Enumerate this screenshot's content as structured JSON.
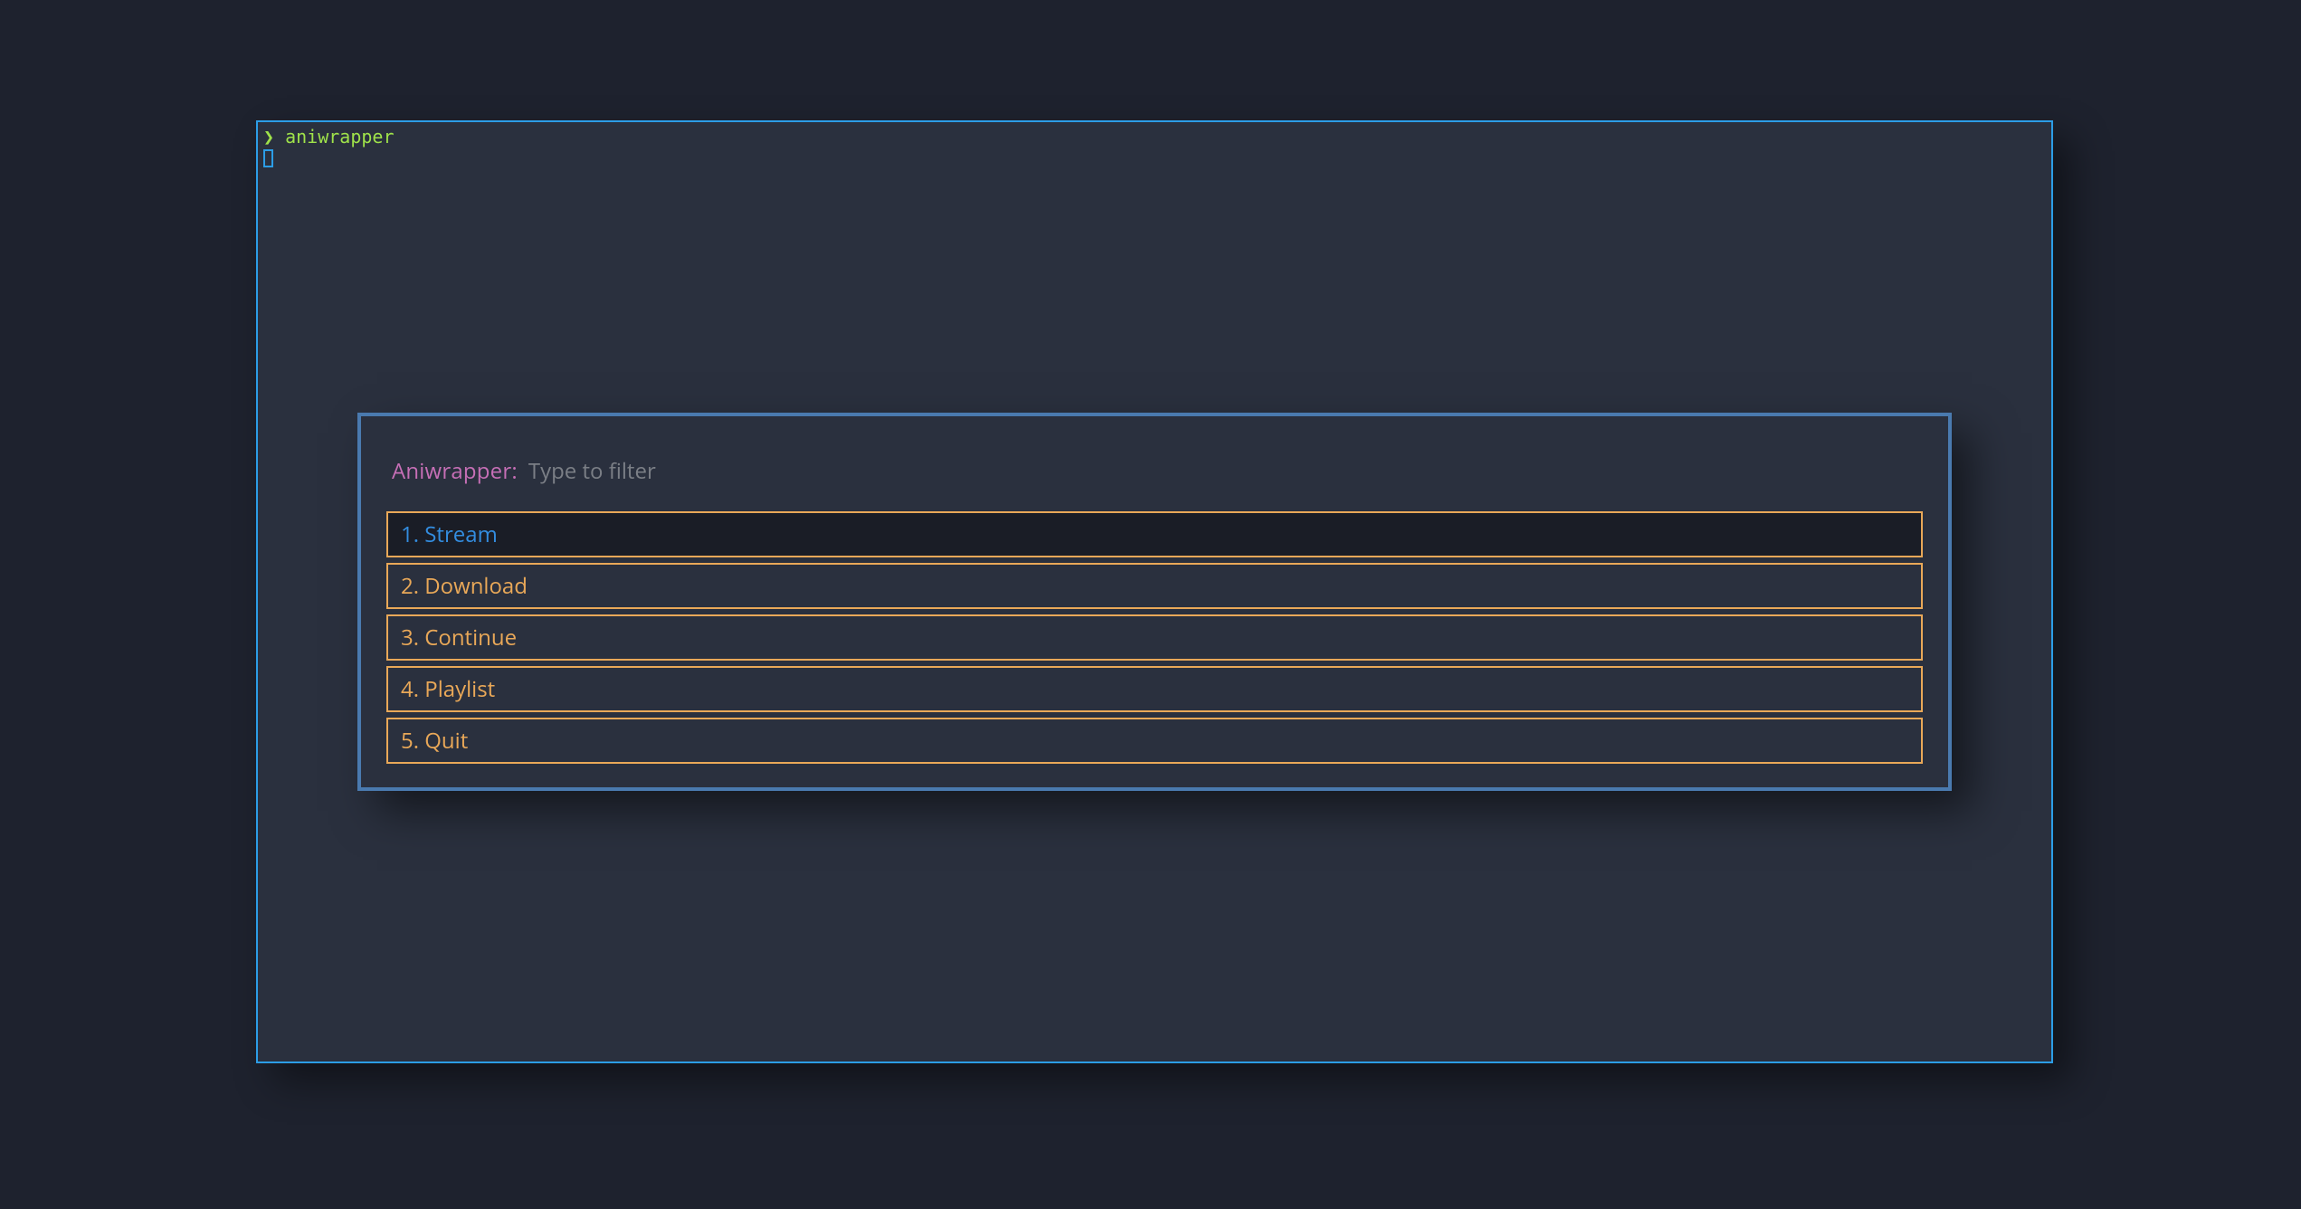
{
  "terminal": {
    "prompt_chevron": "❯",
    "command": "aniwrapper"
  },
  "dialog": {
    "label": "Aniwrapper:",
    "placeholder": "Type to filter",
    "options": [
      {
        "label": "1. Stream",
        "selected": true
      },
      {
        "label": "2. Download",
        "selected": false
      },
      {
        "label": "3. Continue",
        "selected": false
      },
      {
        "label": "4. Playlist",
        "selected": false
      },
      {
        "label": "5. Quit",
        "selected": false
      }
    ]
  },
  "colors": {
    "bg": "#1e222e",
    "panel": "#2a303e",
    "terminal_border": "#2c9de6",
    "dialog_border": "#4a7aaf",
    "option_border": "#e9a858",
    "option_text": "#e9a858",
    "selected_bg": "#1a1d26",
    "selected_text": "#338de0",
    "prompt": "#9fe24a",
    "label": "#c66fb6",
    "placeholder": "#7b7f86"
  }
}
